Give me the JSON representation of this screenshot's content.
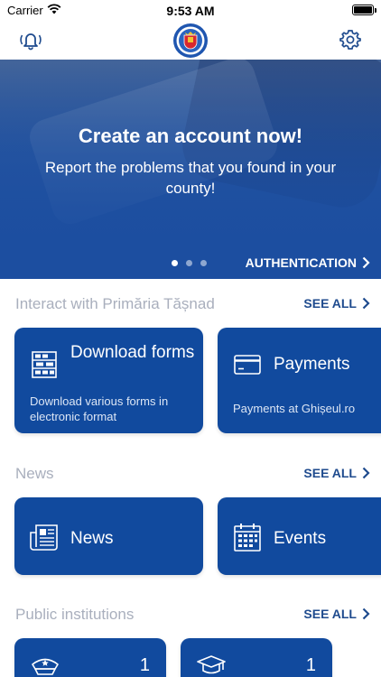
{
  "status": {
    "carrier": "Carrier",
    "time": "9:53 AM"
  },
  "hero": {
    "title": "Create an account now!",
    "subtitle": "Report the problems that you found in your county!",
    "auth_label": "AUTHENTICATION",
    "pages": 3,
    "active_page": 1
  },
  "interact": {
    "label": "Interact with Primăria Tășnad",
    "see_all": "SEE ALL",
    "cards": [
      {
        "title": "Download forms",
        "desc": "Download various forms in electronic format",
        "icon": "forms-icon"
      },
      {
        "title": "Payments",
        "desc": "Payments at Ghișeul.ro",
        "icon": "credit-card-icon"
      }
    ]
  },
  "news": {
    "label": "News",
    "see_all": "SEE ALL",
    "cards": [
      {
        "title": "News",
        "icon": "newspaper-icon"
      },
      {
        "title": "Events",
        "icon": "calendar-icon"
      }
    ]
  },
  "institutions": {
    "label": "Public institutions",
    "see_all": "SEE ALL",
    "cards": [
      {
        "count": "1",
        "icon": "police-cap-icon"
      },
      {
        "count": "1",
        "icon": "graduation-cap-icon"
      }
    ]
  },
  "colors": {
    "primary": "#114a9e",
    "link": "#1f4b8e",
    "muted": "#a9afbd"
  }
}
